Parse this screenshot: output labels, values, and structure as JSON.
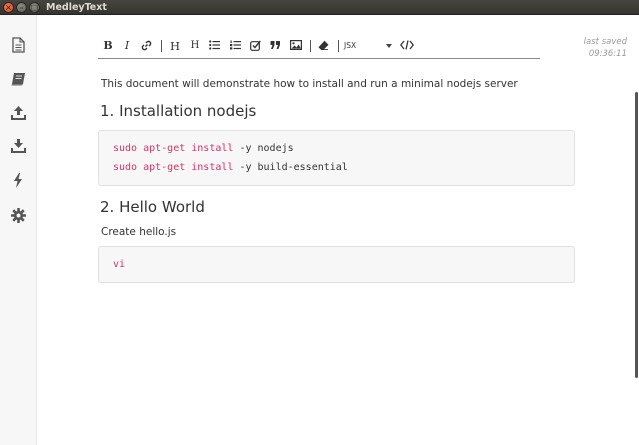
{
  "window": {
    "title": "MedleyText",
    "close_glyph": "×",
    "min_glyph": "–",
    "max_glyph": "□"
  },
  "sidebar": {
    "items": [
      {
        "icon": "document-icon"
      },
      {
        "icon": "notebook-icon"
      },
      {
        "icon": "upload-icon"
      },
      {
        "icon": "download-icon"
      },
      {
        "icon": "lightning-icon"
      },
      {
        "icon": "gear-icon"
      }
    ]
  },
  "toolbar": {
    "bold": "B",
    "italic": "I",
    "heading1": "H",
    "heading2": "H",
    "language": "JSX"
  },
  "status": {
    "label": "last saved",
    "time": "09:36:11"
  },
  "document": {
    "intro": "This document will demonstrate how to install and run a minimal nodejs server",
    "section1_title": "1. Installation nodejs",
    "code1": [
      {
        "cmd": "sudo apt-get install",
        "args": " -y nodejs"
      },
      {
        "cmd": "sudo apt-get install",
        "args": " -y build-essential"
      }
    ],
    "section2_title": "2. Hello World",
    "section2_text": "Create hello.js",
    "code2": [
      {
        "cmd": "vi",
        "args": ""
      }
    ]
  },
  "colors": {
    "code_keyword": "#d1346a",
    "titlebar": "#3c3b37",
    "close_button": "#dd4814"
  }
}
